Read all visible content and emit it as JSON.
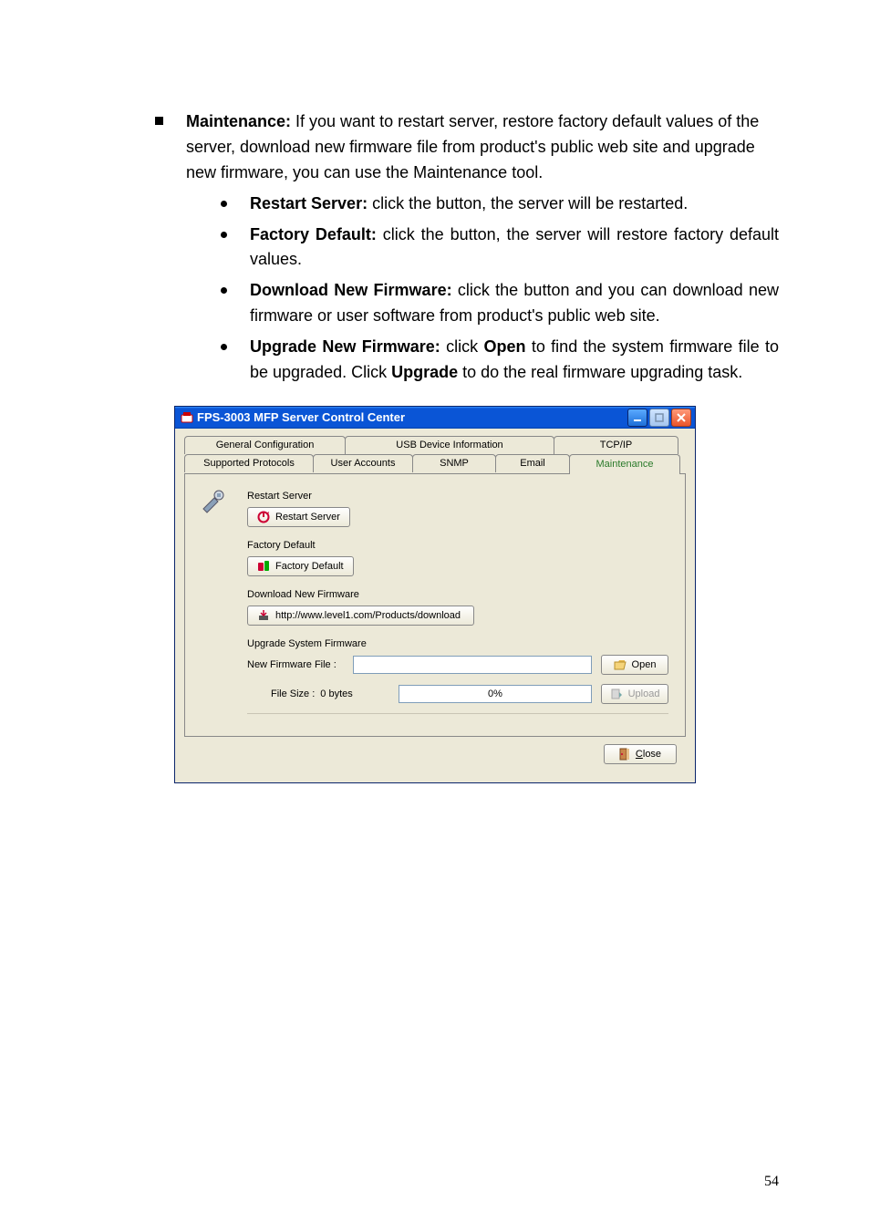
{
  "doc": {
    "maintenance_label": "Maintenance:",
    "maintenance_text": " If you want to restart server, restore factory default values of the server, download new firmware file from product's public web site and upgrade new firmware, you can use the Maintenance tool.",
    "li1_label": "Restart Server:",
    "li1_text": " click the button, the server will be restarted.",
    "li2_label": "Factory Default:",
    "li2_text": " click the button, the server will restore factory default values.",
    "li3_label": "Download New Firmware:",
    "li3_text": " click the button and you can download new firmware or user software from product's public web site.",
    "li4_label": "Upgrade New Firmware:",
    "li4_mid1": " click ",
    "li4_b1": "Open",
    "li4_mid2": " to find the system firmware file to be upgraded. Click ",
    "li4_b2": "Upgrade",
    "li4_mid3": " to do the real firmware upgrading task.",
    "page_number": "54"
  },
  "win": {
    "title": "FPS-3003 MFP Server Control Center",
    "tabs_top": [
      "General Configuration",
      "USB Device Information",
      "TCP/IP"
    ],
    "tabs_bottom": [
      "Supported Protocols",
      "User Accounts",
      "SNMP",
      "Email",
      "Maintenance"
    ],
    "sec_restart": "Restart Server",
    "btn_restart": "Restart Server",
    "sec_factory": "Factory Default",
    "btn_factory": "Factory Default",
    "sec_download": "Download New Firmware",
    "btn_download": "http://www.level1.com/Products/download",
    "sec_upgrade": "Upgrade System Firmware",
    "lbl_newfile": "New Firmware File :",
    "btn_open": "Open",
    "lbl_filesize": "File Size :",
    "val_filesize": "0 bytes",
    "progress_text": "0%",
    "btn_upload": "Upload",
    "btn_close": "Close"
  }
}
